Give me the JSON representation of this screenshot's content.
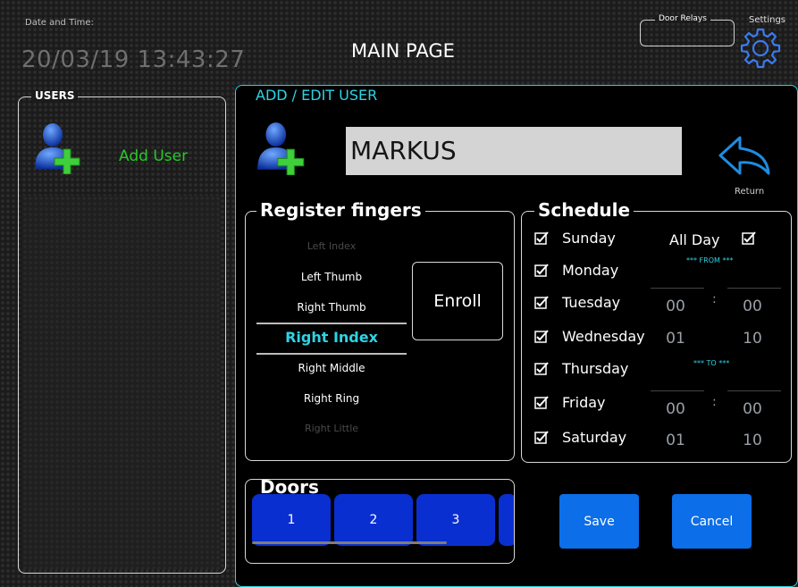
{
  "header": {
    "datetime_label": "Date and Time:",
    "datetime_value": "20/03/19 13:43:27",
    "page_title": "MAIN PAGE",
    "door_relays_label": "Door Relays",
    "settings_label": "Settings"
  },
  "users_panel": {
    "title": "USERS",
    "add_user_label": "Add User"
  },
  "edit_panel": {
    "title": "ADD / EDIT USER",
    "user_name": "MARKUS",
    "return_label": "Return"
  },
  "fingers": {
    "title": "Register fingers",
    "items": [
      "Left Index",
      "Left Thumb",
      "Right Thumb",
      "Right Index",
      "Right Middle",
      "Right Ring",
      "Right  Little"
    ],
    "selected": "Right Index",
    "enroll_label": "Enroll"
  },
  "schedule": {
    "title": "Schedule",
    "days": [
      {
        "label": "Sunday",
        "checked": true
      },
      {
        "label": "Monday",
        "checked": true
      },
      {
        "label": "Tuesday",
        "checked": true
      },
      {
        "label": "Wednesday",
        "checked": true
      },
      {
        "label": "Thursday",
        "checked": true
      },
      {
        "label": "Friday",
        "checked": true
      },
      {
        "label": "Saturday",
        "checked": true
      }
    ],
    "all_day_label": "All Day",
    "all_day_checked": true,
    "from_label": "*** FROM ***",
    "to_label": "*** TO ***",
    "from_hour": [
      "00",
      "01"
    ],
    "from_minute": [
      "00",
      "10"
    ],
    "to_hour": [
      "00",
      "01"
    ],
    "to_minute": [
      "00",
      "10"
    ],
    "separator": ":"
  },
  "doors": {
    "title": "Doors",
    "buttons": [
      "1",
      "2",
      "3"
    ]
  },
  "actions": {
    "save_label": "Save",
    "cancel_label": "Cancel"
  },
  "colors": {
    "accent_cyan": "#2ed3e4",
    "user_green": "#27c928",
    "door_blue": "#0a2fd0",
    "action_blue": "#0c6ee8"
  },
  "icons": {
    "settings": "gear-icon",
    "return": "return-arrow-icon",
    "add_user": "add-user-icon",
    "checkbox": "checkbox-checked-icon"
  }
}
